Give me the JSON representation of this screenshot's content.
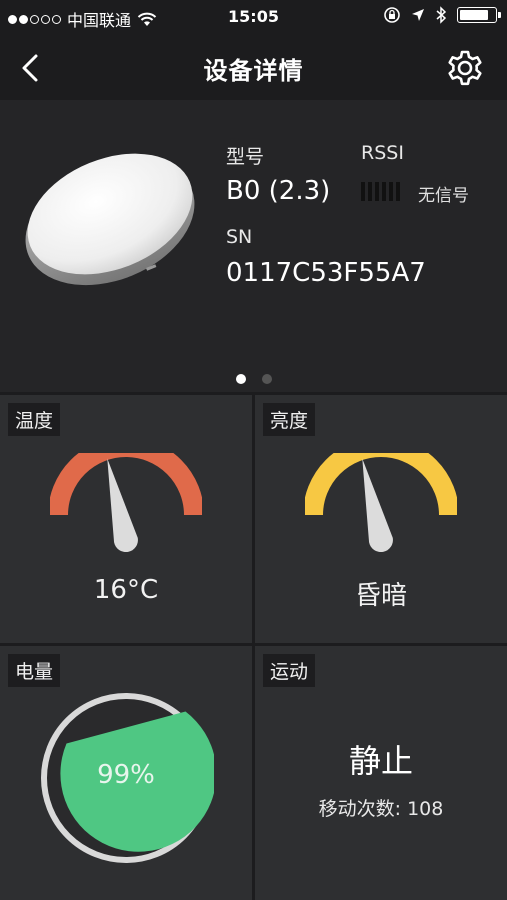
{
  "status_bar": {
    "carrier": "中国联通",
    "time": "15:05"
  },
  "nav": {
    "title": "设备详情"
  },
  "device": {
    "model_label": "型号",
    "model_value": "B0 (2.3)",
    "rssi_label": "RSSI",
    "rssi_status": "无信号",
    "sn_label": "SN",
    "sn_value": "0117C53F55A7",
    "page_count": 2,
    "active_page": 1
  },
  "tiles": {
    "temperature": {
      "label": "温度",
      "value": "16°C",
      "gauge_color": "#e06a4a"
    },
    "brightness": {
      "label": "亮度",
      "value": "昏暗",
      "gauge_color": "#f7c843"
    },
    "battery": {
      "label": "电量",
      "value": "99%",
      "level": 0.99,
      "color": "#4fc783"
    },
    "motion": {
      "label": "运动",
      "state": "静止",
      "count_text": "移动次数: 108"
    }
  }
}
